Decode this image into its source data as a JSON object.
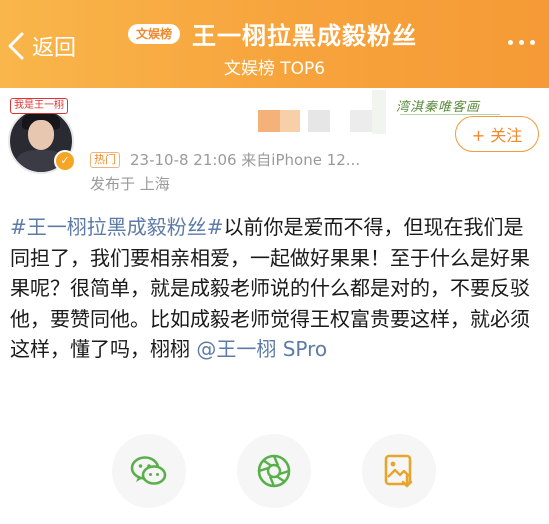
{
  "header": {
    "back_label": "返回",
    "badge": "文娱榜",
    "title": "王一栩拉黑成毅粉丝",
    "subtitle": "文娱榜 TOP6"
  },
  "user": {
    "avatar_tag": "我是王一栩",
    "follow_label": "+ 关注",
    "deco_text": "湾淇秦唯客画"
  },
  "meta": {
    "hot_badge": "热门",
    "time_source": "23-10-8 21:06  来自iPhone 12...",
    "location": "发布于 上海"
  },
  "post": {
    "hashtag": "#王一栩拉黑成毅粉丝#",
    "text": "以前你是爱而不得，但现在我们是同担了，我们要相亲相爱，一起做好果果！至于什么是好果果呢？很简单，就是成毅老师说的什么都是对的，不要反驳他，要赞同他。比如成毅老师觉得王权富贵要这样，就必须这样，懂了吗，栩栩 ",
    "mention": "@王一栩 SPro"
  },
  "share_actions": [
    {
      "icon": "wechat-icon"
    },
    {
      "icon": "moments-icon"
    },
    {
      "icon": "save-image-icon"
    }
  ],
  "colors": {
    "header_orange": "#f7a33c",
    "link_blue": "#5d7ba7",
    "wechat_green": "#59b04a",
    "image_yellow": "#e7a52b"
  }
}
